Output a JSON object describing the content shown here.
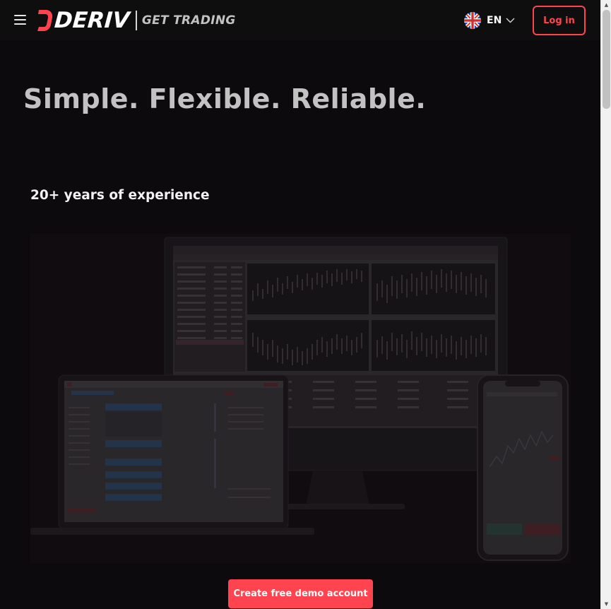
{
  "header": {
    "logo_text": "DERIV",
    "logo_tagline": "GET TRADING",
    "language": {
      "code": "EN",
      "flag_icon": "uk-flag-icon"
    },
    "login_label": "Log in"
  },
  "main": {
    "headline": "Simple. Flexible. Reliable.",
    "subheading": "20+ years of experience",
    "hero_image": {
      "alt": "Trading platform on desktop, laptop and mobile"
    },
    "cta_label": "Create free demo account"
  },
  "colors": {
    "background": "#0d0a0d",
    "accent": "#ff444f",
    "headline": "#c2c2c2"
  }
}
